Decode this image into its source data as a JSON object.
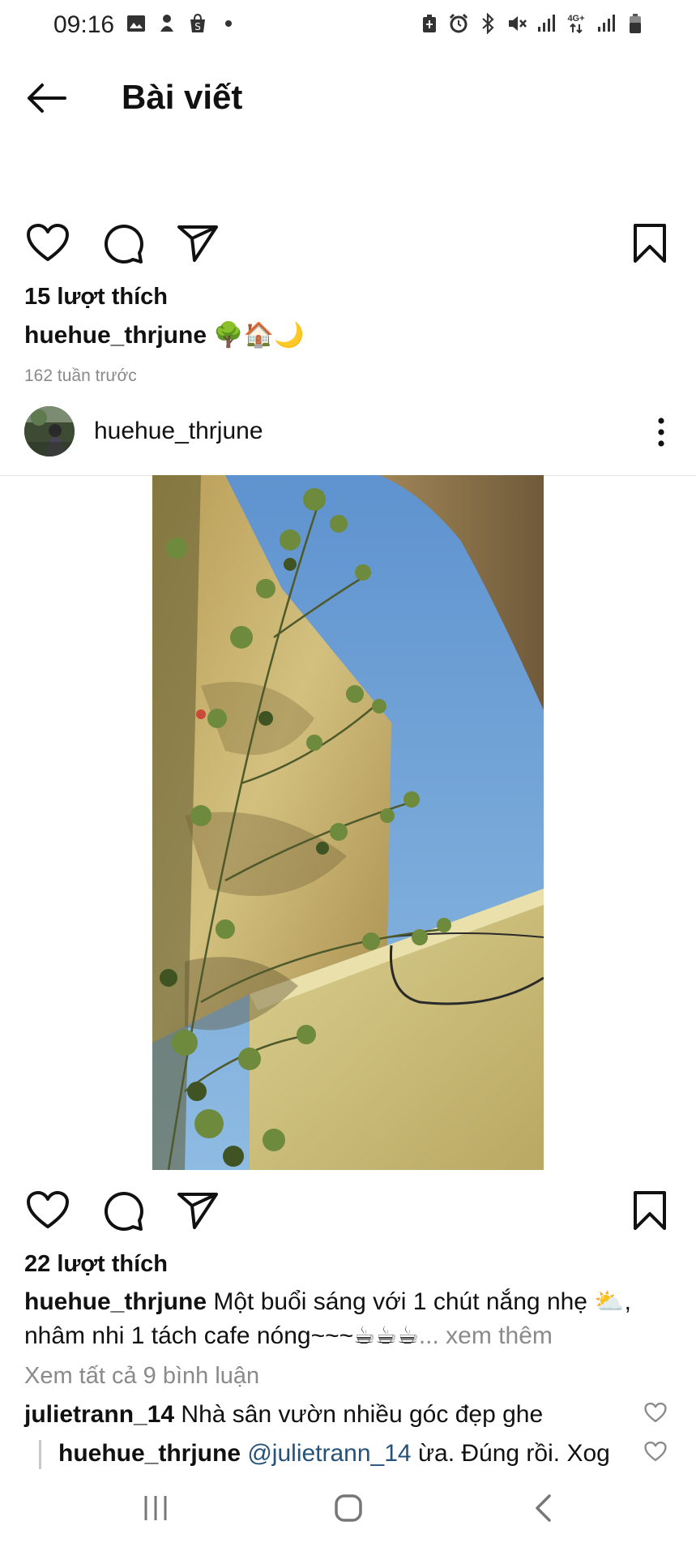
{
  "status_bar": {
    "time": "09:16",
    "left_icons": [
      "image-icon",
      "shape-icon",
      "shopee-icon",
      "dot-icon"
    ],
    "right_icons": [
      "battery-saver-icon",
      "alarm-icon",
      "bluetooth-icon",
      "mute-icon",
      "signal-icon",
      "network-4g-icon",
      "signal-icon",
      "battery-icon"
    ],
    "network_label": "4G+"
  },
  "header": {
    "title": "Bài viết",
    "back_icon": "arrow-left-icon"
  },
  "previous_post": {
    "likes": "15 lượt thích",
    "caption_user": "huehue_thrjune",
    "caption_text": " 🌳🏠🌙",
    "timestamp": "162 tuần trước"
  },
  "post": {
    "author": "huehue_thrjune",
    "more_icon": "more-vertical-icon",
    "likes": "22 lượt thích",
    "caption_user": "huehue_thrjune",
    "caption_text": " Một buổi sáng với 1 chút nắng nhẹ ⛅, nhâm nhi 1 tách cafe nóng~~~☕☕☕",
    "caption_more": "... xem thêm",
    "view_all_comments": "Xem tất cả 9 bình luận",
    "comments": [
      {
        "user": "julietrann_14",
        "text": " Nhà sân vườn nhiều góc đẹp ghe"
      },
      {
        "user": "huehue_thrjune",
        "mention": " @julietrann_14",
        "text": " ừa. Đúng rồi. Xog"
      }
    ]
  },
  "actions": {
    "like_icon": "heart-icon",
    "comment_icon": "comment-icon",
    "share_icon": "send-icon",
    "save_icon": "bookmark-icon"
  },
  "nav_bar": {
    "recents_icon": "recents-icon",
    "home_icon": "home-icon",
    "back_icon": "back-chevron-icon"
  },
  "colors": {
    "text": "#111111",
    "muted": "#8a8a8a",
    "mention": "#26527a",
    "sky": "#6fa4d6",
    "wall": "#c9b87a"
  }
}
